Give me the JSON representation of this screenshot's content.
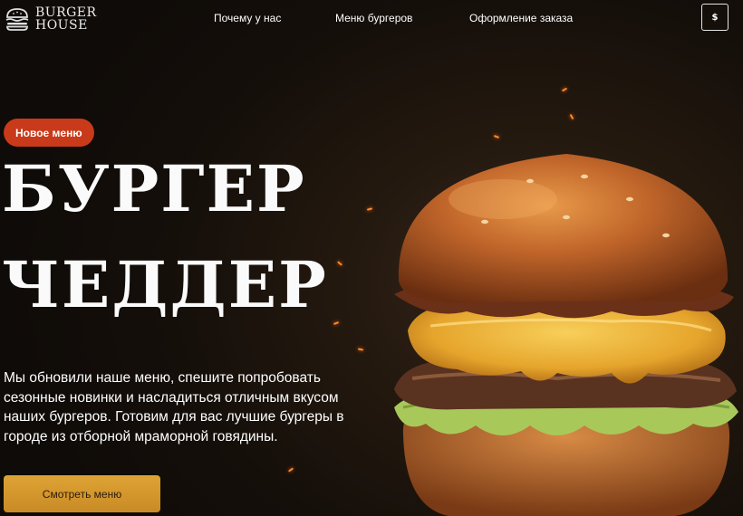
{
  "header": {
    "logo": {
      "line1": "BURGER",
      "line2": "HOUSE",
      "icon": "burger-logo-icon"
    },
    "nav": [
      {
        "label": "Почему у нас"
      },
      {
        "label": "Меню бургеров"
      },
      {
        "label": "Оформление заказа"
      }
    ],
    "cart_button": {
      "label": "$"
    }
  },
  "hero": {
    "badge": "Новое меню",
    "title_line1": "БУРГЕР",
    "title_line2": "ЧЕДДЕР",
    "description": "Мы обновили наше меню, спешите попробовать сезонные новинки и насладиться отличным вкусом наших бургеров. Готовим для вас лучшие бургеры в городе из отборной мраморной говядины.",
    "cta_label": "Смотреть меню"
  },
  "colors": {
    "badge": "#c83a1a",
    "cta": "#d8982f",
    "background": "#150f0a"
  }
}
